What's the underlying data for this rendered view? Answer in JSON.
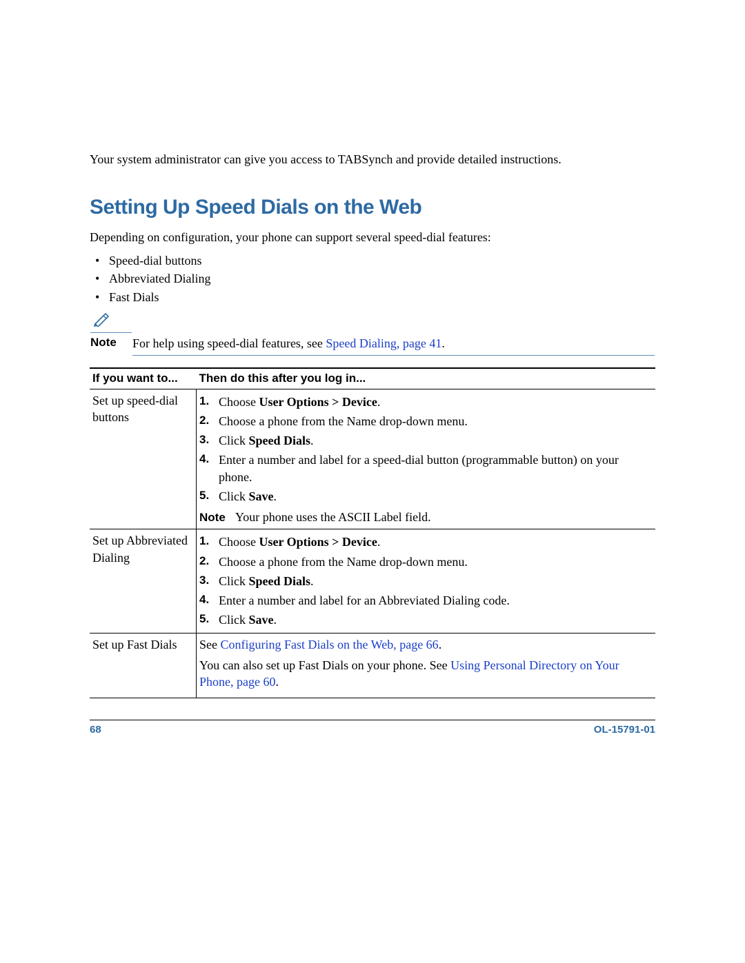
{
  "footer": {
    "page_num": "68",
    "doc_id": "OL-15791-01"
  },
  "intro_para": "Your system administrator can give you access to TABSynch and provide detailed instructions.",
  "heading": "Setting Up Speed Dials on the Web",
  "heading_lead": "Depending on configuration, your phone can support several speed-dial features:",
  "bullets": [
    "Speed-dial buttons",
    "Abbreviated Dialing",
    "Fast Dials"
  ],
  "note": {
    "label": "Note",
    "pre": "For help using speed-dial features, see ",
    "link": "Speed Dialing, page 41",
    "post": "."
  },
  "table_hdr": {
    "col1": "If you want to...",
    "col2": "Then do this after you log in..."
  },
  "row1_label": "Set up speed-dial buttons",
  "row1_steps": [
    {
      "pre": "Choose ",
      "bold": "User Options > Device",
      "post": "."
    },
    {
      "pre": "Choose a phone from the Name drop-down menu.",
      "bold": "",
      "post": ""
    },
    {
      "pre": "Click ",
      "bold": "Speed Dials",
      "post": "."
    },
    {
      "pre": "Enter a number and label for a speed-dial button (programmable button) on your phone.",
      "bold": "",
      "post": ""
    },
    {
      "pre": "Click ",
      "bold": "Save",
      "post": "."
    }
  ],
  "row1_note": {
    "label": "Note",
    "text": "Your phone uses the ASCII Label field."
  },
  "row2_label": "Set up Abbreviated Dialing",
  "row2_steps": [
    {
      "pre": "Choose ",
      "bold": "User Options > Device",
      "post": "."
    },
    {
      "pre": "Choose a phone from the Name drop-down menu.",
      "bold": "",
      "post": ""
    },
    {
      "pre": "Click ",
      "bold": "Speed Dials",
      "post": "."
    },
    {
      "pre": "Enter a number and label for an Abbreviated Dialing code.",
      "bold": "",
      "post": ""
    },
    {
      "pre": "Click ",
      "bold": "Save",
      "post": "."
    }
  ],
  "row3_label": "Set up Fast Dials",
  "row3": {
    "p1_pre": "See ",
    "p1_link": "Configuring Fast Dials on the Web, page 66",
    "p1_post": ".",
    "p2_pre": "You can also set up Fast Dials on your phone. See ",
    "p2_link": "Using Personal Directory on Your Phone, page 60",
    "p2_post": "."
  }
}
